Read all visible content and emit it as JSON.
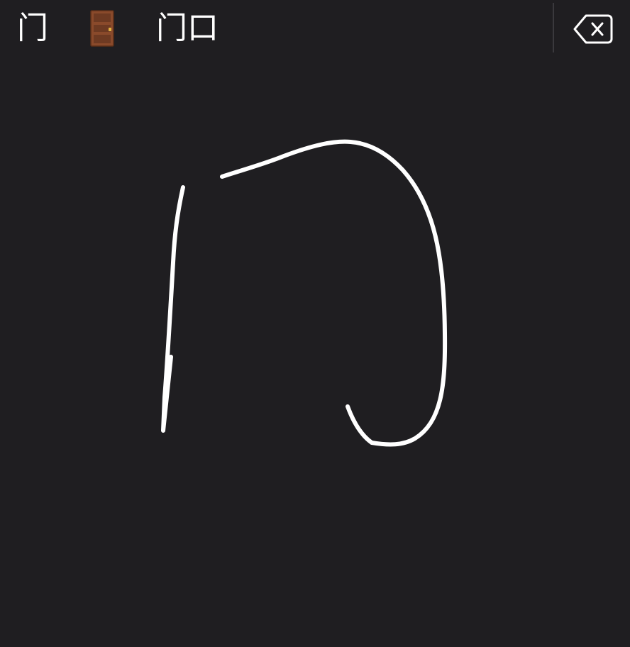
{
  "candidate_bar": {
    "candidates": [
      {
        "label": "门"
      },
      {
        "label": "🚪",
        "icon": "door-icon",
        "kind": "emoji"
      },
      {
        "label": "门口"
      }
    ]
  },
  "delete_key": {
    "icon": "backspace-icon"
  },
  "handwriting_pad": {
    "stroke_color": "#ffffff",
    "stroke_count": 3
  },
  "colors": {
    "background": "#1f1e21",
    "text": "#ffffff",
    "separator": "#3a393d",
    "door_body": "#8a4a2b",
    "door_panel": "#6e3a22",
    "door_knob": "#e3b341"
  }
}
